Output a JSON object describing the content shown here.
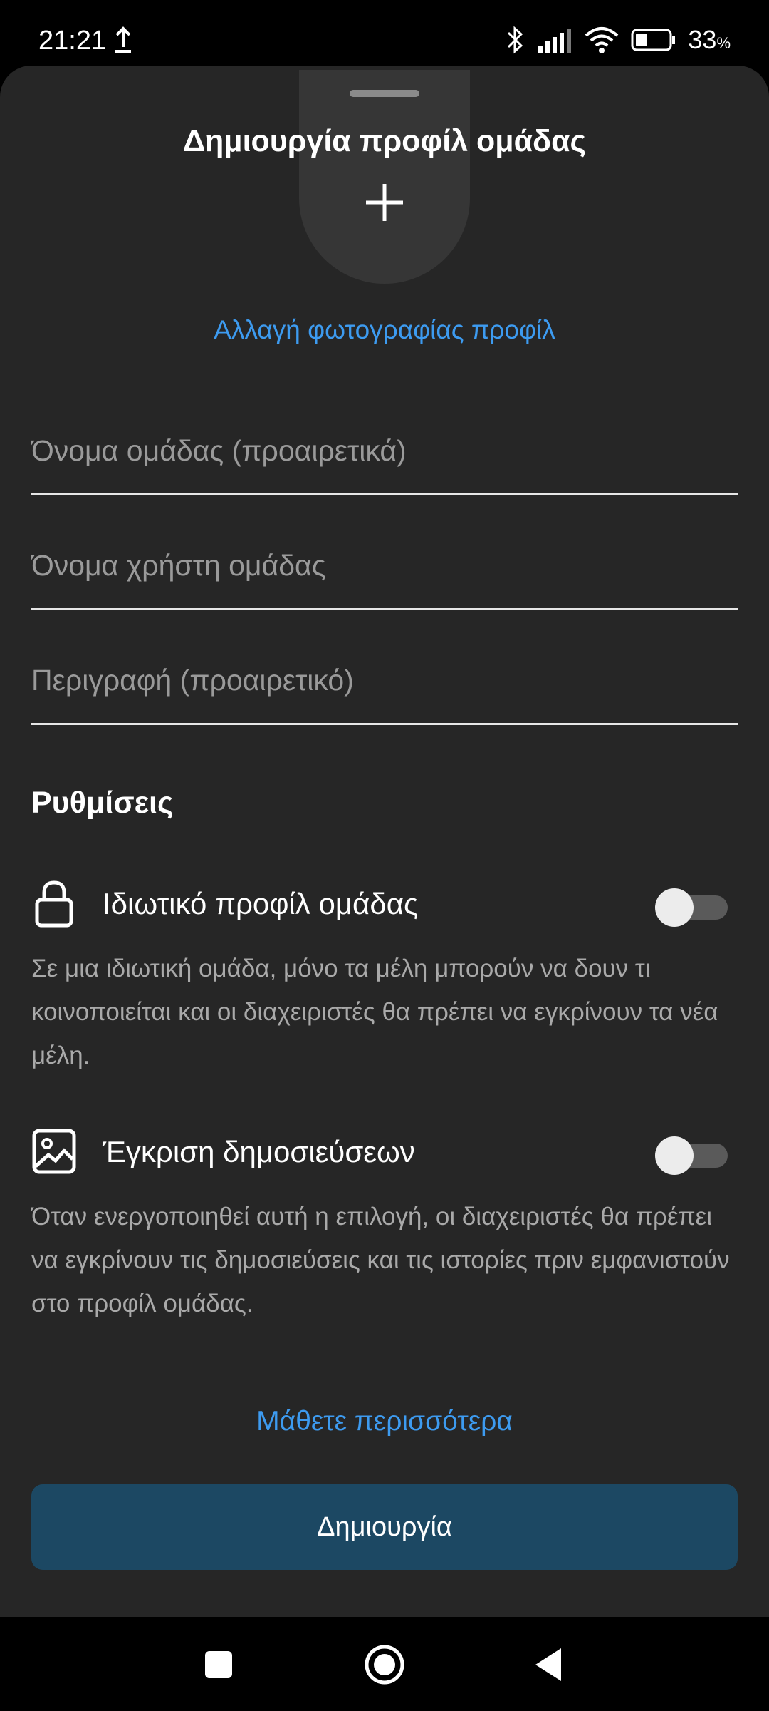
{
  "status_bar": {
    "time": "21:21",
    "battery": "33",
    "battery_unit": "%",
    "upload_icon": "upload-icon",
    "bluetooth_icon": "bluetooth-icon",
    "signal_icon": "signal-icon",
    "wifi_icon": "wifi-icon",
    "battery_icon": "battery-icon"
  },
  "sheet": {
    "title": "Δημιουργία προφίλ ομάδας",
    "change_photo": "Αλλαγή φωτογραφίας προφίλ",
    "fields": {
      "group_name_placeholder": "Όνομα ομάδας (προαιρετικά)",
      "group_username_placeholder": "Όνομα χρήστη ομάδας",
      "description_placeholder": "Περιγραφή (προαιρετικό)"
    },
    "settings_title": "Ρυθμίσεις",
    "private_group": {
      "label": "Ιδιωτικό προφίλ ομάδας",
      "description": "Σε μια ιδιωτική ομάδα, μόνο τα μέλη μπορούν να δουν τι κοινοποιείται και οι διαχειριστές θα πρέπει να εγκρίνουν τα νέα μέλη.",
      "enabled": false
    },
    "post_approval": {
      "label": "Έγκριση δημοσιεύσεων",
      "description": "Όταν ενεργοποιηθεί αυτή η επιλογή, οι διαχειριστές θα πρέπει να εγκρίνουν τις δημοσιεύσεις και τις ιστορίες πριν εμφανιστούν στο προφίλ ομάδας.",
      "enabled": false
    },
    "learn_more": "Μάθετε περισσότερα",
    "create_button": "Δημιουργία"
  },
  "colors": {
    "accent": "#3d9bf0",
    "sheet_bg": "#262626",
    "button_bg": "#1c4863"
  }
}
